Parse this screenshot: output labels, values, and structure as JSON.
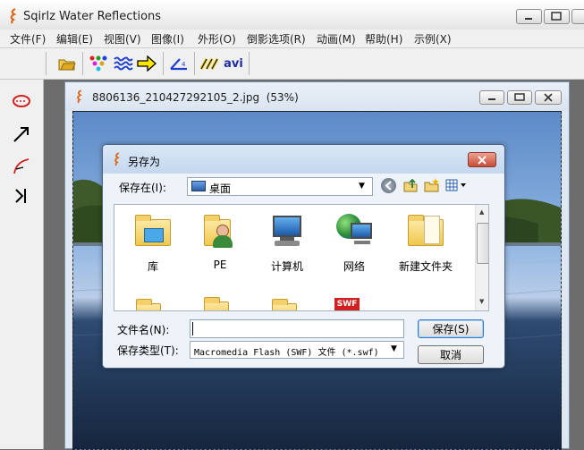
{
  "app": {
    "title": "Sqirlz Water Reflections",
    "menu": [
      "文件(F)",
      "编辑(E)",
      "视图(V)",
      "图像(I)",
      "外形(O)",
      "倒影选项(R)",
      "动画(M)",
      "帮助(H)",
      "示例(X)"
    ],
    "toolbar": {
      "avi_label": "avi"
    }
  },
  "image_window": {
    "title": "8806136_210427292105_2.jpg",
    "zoom": "(53%)"
  },
  "dialog": {
    "title": "另存为",
    "save_in_label": "保存在(I):",
    "save_in_value": "桌面",
    "files": [
      {
        "name": "库"
      },
      {
        "name": "PE"
      },
      {
        "name": "计算机"
      },
      {
        "name": "网络"
      },
      {
        "name": "新建文件夹"
      }
    ],
    "swf_badge": "SWF",
    "filename_label": "文件名(N):",
    "filename_value": "",
    "filetype_label": "保存类型(T):",
    "filetype_value": "Macromedia Flash (SWF) 文件 (*.swf)",
    "save_button": "保存(S)",
    "cancel_button": "取消"
  },
  "colors": {
    "app_icon": "#d96a1e",
    "dialog_close": "#c94a34",
    "accent": "#2a5ea8"
  }
}
